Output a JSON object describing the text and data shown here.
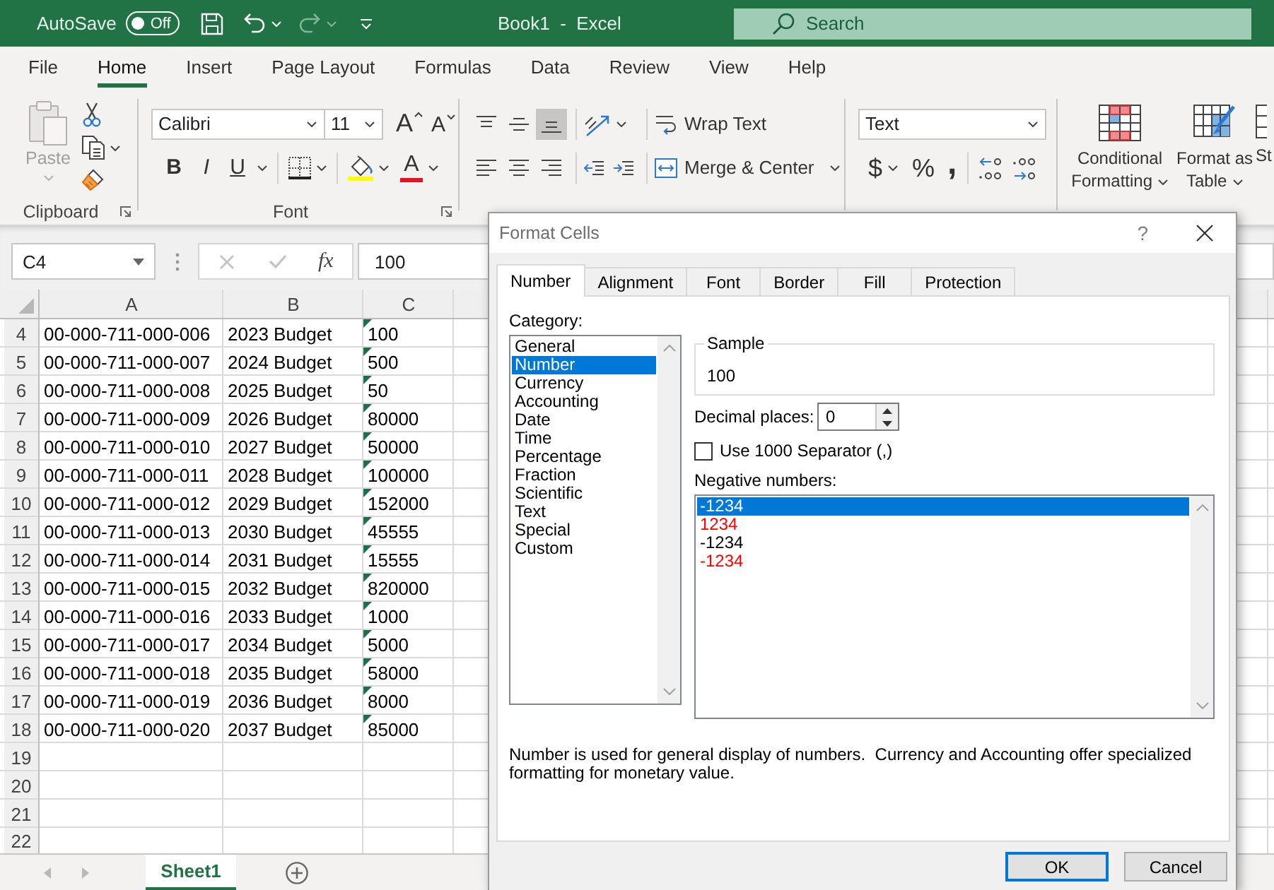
{
  "title_bar": {
    "autosave": {
      "label": "AutoSave",
      "state": "Off",
      "on": false
    },
    "quick_access": {
      "undo_disabled": false,
      "redo_disabled": true
    },
    "title": "Book1  -  Excel",
    "search": {
      "placeholder": "Search"
    }
  },
  "ribbon_tabs": [
    {
      "label": "File",
      "selected": false
    },
    {
      "label": "Home",
      "selected": true
    },
    {
      "label": "Insert",
      "selected": false
    },
    {
      "label": "Page Layout",
      "selected": false
    },
    {
      "label": "Formulas",
      "selected": false
    },
    {
      "label": "Data",
      "selected": false
    },
    {
      "label": "Review",
      "selected": false
    },
    {
      "label": "View",
      "selected": false
    },
    {
      "label": "Help",
      "selected": false
    }
  ],
  "ribbon": {
    "clipboard": {
      "paste": {
        "label": "Paste",
        "disabled": true
      },
      "label": "Clipboard"
    },
    "font": {
      "name": "Calibri",
      "size": "11",
      "grow_font": "A",
      "shrink_font": "A",
      "bold": "B",
      "italic": "I",
      "underline": "U",
      "font_color": "A",
      "label": "Font"
    },
    "alignment": {
      "vertical": [
        {
          "kind": "top",
          "selected": false
        },
        {
          "kind": "middle",
          "selected": false
        },
        {
          "kind": "bottom",
          "selected": true
        }
      ],
      "horizontal": [
        {
          "kind": "left",
          "selected": false
        },
        {
          "kind": "center",
          "selected": false
        },
        {
          "kind": "right",
          "selected": false
        }
      ],
      "wrap_text": "Wrap Text",
      "merge_center": "Merge & Center"
    },
    "number": {
      "format": "Text",
      "currency": "$",
      "percent": "%",
      "comma": ","
    },
    "styles": {
      "conditional_formatting": "Conditional Formatting",
      "format_as_table": "Format as Table",
      "cell_styles": "St"
    }
  },
  "formula_bar": {
    "name_box": "C4",
    "edit_disabled": true,
    "insert_function": "fx",
    "value": "100"
  },
  "sheet": {
    "columns": [
      "A",
      "B",
      "C"
    ],
    "rows": [
      {
        "header": "4",
        "cells": [
          {
            "text": "00-000-711-000-006",
            "flagged": false
          },
          {
            "text": "2023 Budget",
            "flagged": false
          },
          {
            "text": "100",
            "flagged": true
          }
        ]
      },
      {
        "header": "5",
        "cells": [
          {
            "text": "00-000-711-000-007",
            "flagged": false
          },
          {
            "text": "2024 Budget",
            "flagged": false
          },
          {
            "text": "500",
            "flagged": true
          }
        ]
      },
      {
        "header": "6",
        "cells": [
          {
            "text": "00-000-711-000-008",
            "flagged": false
          },
          {
            "text": "2025 Budget",
            "flagged": false
          },
          {
            "text": "50",
            "flagged": true
          }
        ]
      },
      {
        "header": "7",
        "cells": [
          {
            "text": "00-000-711-000-009",
            "flagged": false
          },
          {
            "text": "2026 Budget",
            "flagged": false
          },
          {
            "text": "80000",
            "flagged": true
          }
        ]
      },
      {
        "header": "8",
        "cells": [
          {
            "text": "00-000-711-000-010",
            "flagged": false
          },
          {
            "text": "2027 Budget",
            "flagged": false
          },
          {
            "text": "50000",
            "flagged": true
          }
        ]
      },
      {
        "header": "9",
        "cells": [
          {
            "text": "00-000-711-000-011",
            "flagged": false
          },
          {
            "text": "2028 Budget",
            "flagged": false
          },
          {
            "text": "100000",
            "flagged": true
          }
        ]
      },
      {
        "header": "10",
        "cells": [
          {
            "text": "00-000-711-000-012",
            "flagged": false
          },
          {
            "text": "2029 Budget",
            "flagged": false
          },
          {
            "text": "152000",
            "flagged": true
          }
        ]
      },
      {
        "header": "11",
        "cells": [
          {
            "text": "00-000-711-000-013",
            "flagged": false
          },
          {
            "text": "2030 Budget",
            "flagged": false
          },
          {
            "text": "45555",
            "flagged": true
          }
        ]
      },
      {
        "header": "12",
        "cells": [
          {
            "text": "00-000-711-000-014",
            "flagged": false
          },
          {
            "text": "2031 Budget",
            "flagged": false
          },
          {
            "text": "15555",
            "flagged": true
          }
        ]
      },
      {
        "header": "13",
        "cells": [
          {
            "text": "00-000-711-000-015",
            "flagged": false
          },
          {
            "text": "2032 Budget",
            "flagged": false
          },
          {
            "text": "820000",
            "flagged": true
          }
        ]
      },
      {
        "header": "14",
        "cells": [
          {
            "text": "00-000-711-000-016",
            "flagged": false
          },
          {
            "text": "2033 Budget",
            "flagged": false
          },
          {
            "text": "1000",
            "flagged": true
          }
        ]
      },
      {
        "header": "15",
        "cells": [
          {
            "text": "00-000-711-000-017",
            "flagged": false
          },
          {
            "text": "2034 Budget",
            "flagged": false
          },
          {
            "text": "5000",
            "flagged": true
          }
        ]
      },
      {
        "header": "16",
        "cells": [
          {
            "text": "00-000-711-000-018",
            "flagged": false
          },
          {
            "text": "2035 Budget",
            "flagged": false
          },
          {
            "text": "58000",
            "flagged": true
          }
        ]
      },
      {
        "header": "17",
        "cells": [
          {
            "text": "00-000-711-000-019",
            "flagged": false
          },
          {
            "text": "2036 Budget",
            "flagged": false
          },
          {
            "text": "8000",
            "flagged": true
          }
        ]
      },
      {
        "header": "18",
        "cells": [
          {
            "text": "00-000-711-000-020",
            "flagged": false
          },
          {
            "text": "2037 Budget",
            "flagged": false
          },
          {
            "text": "85000",
            "flagged": true
          }
        ]
      },
      {
        "header": "19"
      },
      {
        "header": "20"
      },
      {
        "header": "21"
      },
      {
        "header": "22"
      }
    ]
  },
  "sheet_tabs": {
    "sheets": [
      {
        "label": "Sheet1",
        "selected": true
      }
    ]
  },
  "format_cells_dialog": {
    "title": "Format Cells",
    "help": "?",
    "tabs": [
      {
        "label": "Number",
        "selected": true
      },
      {
        "label": "Alignment",
        "selected": false
      },
      {
        "label": "Font",
        "selected": false
      },
      {
        "label": "Border",
        "selected": false
      },
      {
        "label": "Fill",
        "selected": false
      },
      {
        "label": "Protection",
        "selected": false
      }
    ],
    "category": {
      "label": "Category:",
      "items": [
        {
          "label": "General",
          "selected": false
        },
        {
          "label": "Number",
          "selected": true
        },
        {
          "label": "Currency",
          "selected": false
        },
        {
          "label": "Accounting",
          "selected": false
        },
        {
          "label": "Date",
          "selected": false
        },
        {
          "label": "Time",
          "selected": false
        },
        {
          "label": "Percentage",
          "selected": false
        },
        {
          "label": "Fraction",
          "selected": false
        },
        {
          "label": "Scientific",
          "selected": false
        },
        {
          "label": "Text",
          "selected": false
        },
        {
          "label": "Special",
          "selected": false
        },
        {
          "label": "Custom",
          "selected": false
        }
      ]
    },
    "sample": {
      "label": "Sample",
      "value": "100"
    },
    "decimal_places": {
      "label": "Decimal places:",
      "value": "0"
    },
    "thousands_separator": {
      "label": "Use 1000 Separator (,)",
      "checked": false
    },
    "negative_numbers": {
      "label": "Negative numbers:",
      "items": [
        {
          "label": "-1234",
          "selected": true
        },
        {
          "label": "1234",
          "selected": false,
          "color": "#ff0000"
        },
        {
          "label": "-1234",
          "selected": false,
          "color": "#000000"
        },
        {
          "label": "-1234",
          "selected": false,
          "color": "#ff0000"
        }
      ]
    },
    "description": "Number is used for general display of numbers.  Currency and Accounting offer specialized formatting for monetary value.",
    "buttons": [
      {
        "label": "OK",
        "default": true
      },
      {
        "label": "Cancel",
        "default": false
      }
    ]
  }
}
